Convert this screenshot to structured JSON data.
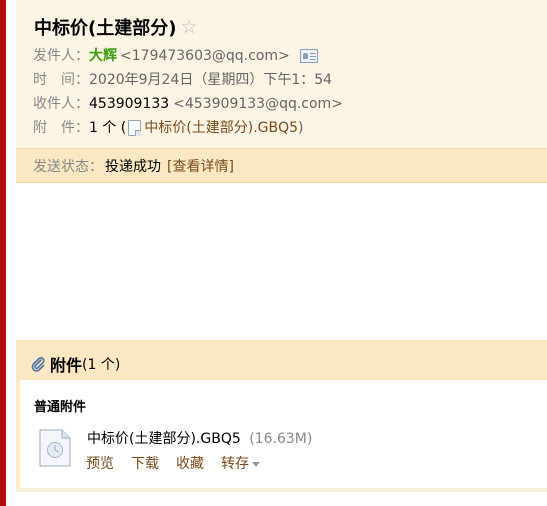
{
  "mail": {
    "subject": "中标价(土建部分)",
    "star_icon": "star-icon",
    "sender_label": "发件人：",
    "sender_name": "大辉",
    "sender_email": "<179473603@qq.com>",
    "contact_icon": "contact-card-icon",
    "time_label": "时　间：",
    "time_value": "2020年9月24日（星期四）下午1：54",
    "recipient_label": "收件人：",
    "recipient_name": "453909133",
    "recipient_email": "<453909133@qq.com>",
    "attachment_label": "附　件：",
    "attachment_count_prefix": "1 个 (",
    "attachment_link": "中标价(土建部分).GBQ5",
    "attachment_close": ")",
    "status_label": "发送状态：",
    "status_value": "投递成功",
    "status_detail": "[查看详情]"
  },
  "attachments": {
    "title": "附件",
    "count": "(1 个)",
    "group_title": "普通附件",
    "files": [
      {
        "name": "中标价(土建部分).GBQ5",
        "size": "(16.63M)",
        "actions": {
          "preview": "预览",
          "download": "下载",
          "favorite": "收藏",
          "save": "转存"
        }
      }
    ]
  },
  "colors": {
    "left_strip": "#b20b0b",
    "header_bg": "#fdf5e4",
    "status_bg": "#fbe8c2",
    "sender_name": "#3c9c0d",
    "link": "#7a4b1a"
  }
}
